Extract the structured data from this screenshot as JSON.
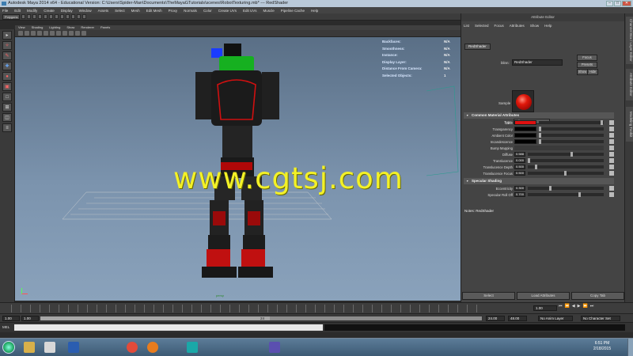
{
  "window": {
    "title": "Autodesk Maya 2014 x64 - Educational Version: C:\\Users\\Spider-Man\\Documents\\TheMayaGTutorials\\scenes\\RobotTexturing.mb* --- RedShader",
    "controls": [
      "–",
      "□",
      "✕"
    ]
  },
  "menubar": [
    "File",
    "Edit",
    "Modify",
    "Create",
    "Display",
    "Window",
    "Assets",
    "Select",
    "Mesh",
    "Edit Mesh",
    "Proxy",
    "Normals",
    "Color",
    "Create UVs",
    "Edit UVs",
    "Muscle",
    "Pipeline Cache",
    "Help"
  ],
  "status_line": {
    "mode": "Polygons"
  },
  "panel_menu": [
    "View",
    "Shading",
    "Lighting",
    "Show",
    "Renderer",
    "Panels"
  ],
  "hud": {
    "rows": [
      {
        "label": "Backfaces:",
        "value": "N/A"
      },
      {
        "label": "Smoothness:",
        "value": "N/A"
      },
      {
        "label": "Instance:",
        "value": "N/A"
      },
      {
        "label": "Display Layer:",
        "value": "N/A"
      },
      {
        "label": "Distance From Camera:",
        "value": "N/A"
      },
      {
        "label": "Selected Objects:",
        "value": "1"
      }
    ]
  },
  "viewport": {
    "camera_label": "persp",
    "watermark": "www.cgtsj.com"
  },
  "attribute_editor": {
    "title": "Attribute Editor",
    "menu": [
      "List",
      "Selected",
      "Focus",
      "Attributes",
      "Show",
      "Help"
    ],
    "tab": "RedShader",
    "material_label": "blinn:",
    "material_name": "RedShader",
    "focus_btn": "Focus",
    "presets_btn": "Presets",
    "show_btn": "Show",
    "hide_btn": "Hide",
    "sample_label": "Sample",
    "type_label": "Type",
    "type_value": "Blinn",
    "section_common": "Common Material Attributes",
    "attributes": [
      {
        "label": "Color",
        "kind": "swatch",
        "color": "#e01010"
      },
      {
        "label": "Transparency",
        "kind": "swatch",
        "color": "#000000"
      },
      {
        "label": "Ambient Color",
        "kind": "swatch",
        "color": "#000000"
      },
      {
        "label": "Incandescence",
        "kind": "swatch",
        "color": "#000000"
      },
      {
        "label": "Bump Mapping",
        "kind": "bump"
      },
      {
        "label": "Diffuse",
        "kind": "value",
        "value": "0.588",
        "level": 0.588
      },
      {
        "label": "Translucence",
        "kind": "value",
        "value": "0.000",
        "level": 0.0
      },
      {
        "label": "Translucence Depth",
        "kind": "value",
        "value": "0.500",
        "level": 0.1
      },
      {
        "label": "Translucence Focus",
        "kind": "value",
        "value": "0.500",
        "level": 0.5
      }
    ],
    "section_specular": "Specular Shading",
    "specular": [
      {
        "label": "Eccentricity",
        "value": "0.300",
        "level": 0.3
      },
      {
        "label": "Specular Roll Off",
        "value": "0.700",
        "level": 0.7
      }
    ],
    "notes_label": "Notes: RedShader",
    "bottom_buttons": [
      "Select",
      "Load Attributes",
      "Copy Tab"
    ]
  },
  "side_tabs": [
    "Channel Box / Layer Editor",
    "Attribute Editor",
    "Modeling Toolkit"
  ],
  "timeline": {
    "start": "1.00",
    "current": "1.00",
    "range_start": "1.00",
    "range_end_a": "24.00",
    "range_end_b": "48.00",
    "slider_value": "24",
    "anim_layer": "No Anim Layer",
    "char_set": "No Character Set"
  },
  "command_line": {
    "label": "MEL"
  },
  "taskbar": {
    "time": "6:51 PM",
    "date": "2/18/2015",
    "apps": [
      {
        "name": "explorer",
        "color": "#d8b04a"
      },
      {
        "name": "media-player",
        "color": "#d8d8d8"
      },
      {
        "name": "photoshop",
        "color": "#2a5db0"
      },
      {
        "name": "chrome",
        "color": "#e24b3a"
      },
      {
        "name": "firefox",
        "color": "#e87c1e"
      },
      {
        "name": "maya",
        "color": "#1aa8a8"
      },
      {
        "name": "after-effects",
        "color": "#5b4fb0"
      }
    ]
  }
}
